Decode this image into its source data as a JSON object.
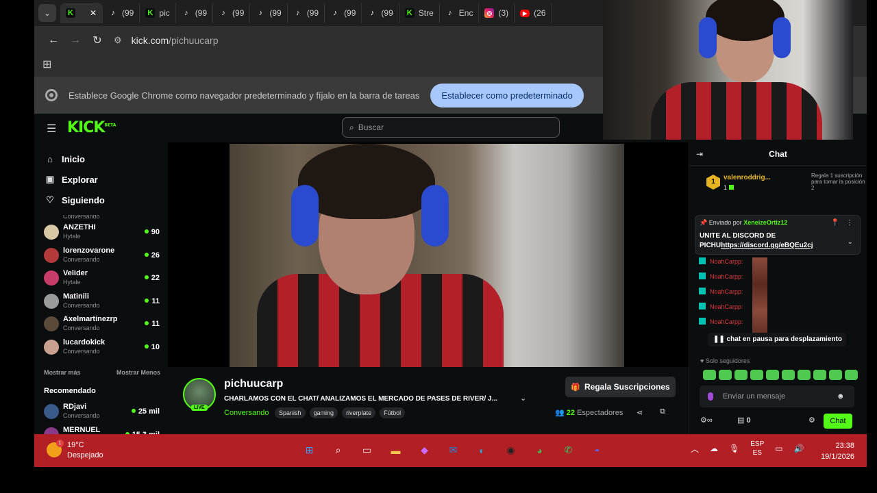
{
  "browser": {
    "tabs": [
      {
        "icon": "kick-icon",
        "label": "",
        "active": true
      },
      {
        "icon": "tiktok-icon",
        "label": "(99"
      },
      {
        "icon": "kick-icon",
        "label": "pic"
      },
      {
        "icon": "tiktok-icon",
        "label": "(99"
      },
      {
        "icon": "tiktok-icon",
        "label": "(99"
      },
      {
        "icon": "tiktok-icon",
        "label": "(99"
      },
      {
        "icon": "tiktok-icon",
        "label": "(99"
      },
      {
        "icon": "tiktok-icon",
        "label": "(99"
      },
      {
        "icon": "tiktok-icon",
        "label": "(99"
      },
      {
        "icon": "kick-icon",
        "label": "Stre"
      },
      {
        "icon": "tiktok-icon",
        "label": "Enc"
      },
      {
        "icon": "instagram-icon",
        "label": "(3)"
      },
      {
        "icon": "youtube-icon",
        "label": "(26"
      }
    ],
    "url_host": "kick.com",
    "url_path": "/pichuucarp",
    "banner_text": "Establece Google Chrome como navegador predeterminado y fíjalo en la barra de tareas",
    "banner_button": "Establecer como predeterminado"
  },
  "kick": {
    "logo": "KICK",
    "logo_badge": "BETA",
    "search_placeholder": "Buscar",
    "nav": [
      {
        "icon": "home-icon",
        "label": "Inicio"
      },
      {
        "icon": "browse-icon",
        "label": "Explorar"
      },
      {
        "icon": "heart-icon",
        "label": "Siguiendo"
      }
    ],
    "top_cut_text": "Conversando",
    "following": [
      {
        "name": "ANZETHI",
        "category": "Hytale",
        "viewers": "90",
        "color": "#d9c6a5"
      },
      {
        "name": "lorenzovarone",
        "category": "Conversando",
        "viewers": "26",
        "color": "#b33a3a"
      },
      {
        "name": "Velider",
        "category": "Hytale",
        "viewers": "22",
        "color": "#c83c6a"
      },
      {
        "name": "Matinili",
        "category": "Conversando",
        "viewers": "11",
        "color": "#9a9a9a"
      },
      {
        "name": "Axelmartinezrp",
        "category": "Conversando",
        "viewers": "11",
        "color": "#5a4a3a"
      },
      {
        "name": "lucardokick",
        "category": "Conversando",
        "viewers": "10",
        "color": "#c9a090"
      }
    ],
    "show_more": "Mostrar más",
    "show_less": "Mostrar Menos",
    "recommended_title": "Recomendado",
    "recommended": [
      {
        "name": "RDjavi",
        "category": "Conversando",
        "viewers": "25 mil",
        "color": "#3a5a8a"
      },
      {
        "name": "MERNUEL",
        "category": "",
        "viewers": "15,3 mil",
        "color": "#8a3a8a"
      }
    ]
  },
  "stream": {
    "channel": "pichuucarp",
    "live_badge": "LIVE",
    "title": "CHARLAMOS CON EL CHAT/ ANALIZAMOS EL MERCADO DE PASES DE RIVER/ J...",
    "category": "Conversando",
    "tags": [
      "Spanish",
      "gaming",
      "riverplate",
      "Fútbol"
    ],
    "gift_button": "Regala Suscripciones",
    "viewers": "22",
    "viewers_label": "Espectadores"
  },
  "chat": {
    "title": "Chat",
    "top_gifter": {
      "name": "valenroddrig...",
      "count": "1",
      "rank": "1"
    },
    "gift_prompt": "Regala 1 suscripción para tomar la posición 2",
    "pinned_by_label": "Enviado por",
    "pinned_by_user": "XeneizeOrtiz12",
    "pinned_message": "UNITE AL DISCORD DE PICHU",
    "pinned_link": "https://discord.gg/eBQEu2cj",
    "messages": [
      {
        "user": "NoahCarpp"
      },
      {
        "user": "NoahCarpp"
      },
      {
        "user": "NoahCarpp"
      },
      {
        "user": "NoahCarpp"
      },
      {
        "user": "NoahCarpp"
      }
    ],
    "paused_text": "chat en pausa para desplazamiento",
    "followers_only": "Solo seguidores",
    "input_placeholder": "Enviar un mensaje",
    "zero_count": "0",
    "send_button": "Chat"
  },
  "taskbar": {
    "temperature": "19°C",
    "weather": "Despejado",
    "weather_badge": "1",
    "apps": [
      "start-icon",
      "search-icon",
      "task-view-icon",
      "file-explorer-icon",
      "copilot-icon",
      "outlook-icon",
      "edge-icon",
      "obs-icon",
      "chrome-icon",
      "whatsapp-icon",
      "discord-icon"
    ],
    "lang_top": "ESP",
    "lang_bottom": "ES",
    "time": "23:38",
    "date": "19/1/2026"
  }
}
